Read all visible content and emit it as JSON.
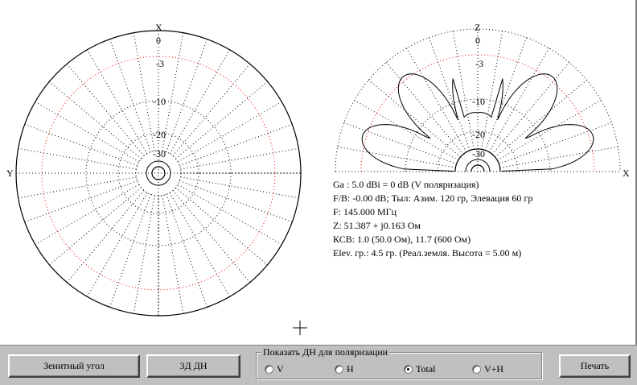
{
  "azimuth_plot": {
    "top_axis_label": "X",
    "left_axis_label": "Y",
    "rings": [
      "0",
      "-3",
      "-10",
      "-20",
      "-30"
    ]
  },
  "elevation_plot": {
    "top_axis_label": "Z",
    "right_axis_label": "X",
    "rings": [
      "0",
      "-3",
      "-10",
      "-20",
      "-30"
    ]
  },
  "info": {
    "gain": "Ga : 5.0 dBi = 0 dB  (V поляризация)",
    "fb": "F/B: -0.00 dB; Тыл: Азим. 120 гр, Элевация 60 гр",
    "freq": "F: 145.000 МГц",
    "impedance": "Z: 51.387 + j0.163 Ом",
    "swr": "КСВ: 1.0 (50.0 Ом), 11.7 (600 Ом)",
    "elevation": "Elev. гр.: 4.5 гр. (Реал.земля. Высота = 5.00 м)"
  },
  "cursor_icon": "crosshair-icon",
  "buttons": {
    "zenith": "Зенитный угол",
    "pattern3d": "3Д   ДН",
    "print": "Печать"
  },
  "polarization": {
    "legend": "Показать ДН для поляризации",
    "options": [
      "V",
      "H",
      "Total",
      "V+H"
    ],
    "selected": "Total"
  },
  "colors": {
    "panel_bg": "#c0c0c0",
    "plot_bg": "#ffffff",
    "ref_ring": "#ff0000"
  }
}
